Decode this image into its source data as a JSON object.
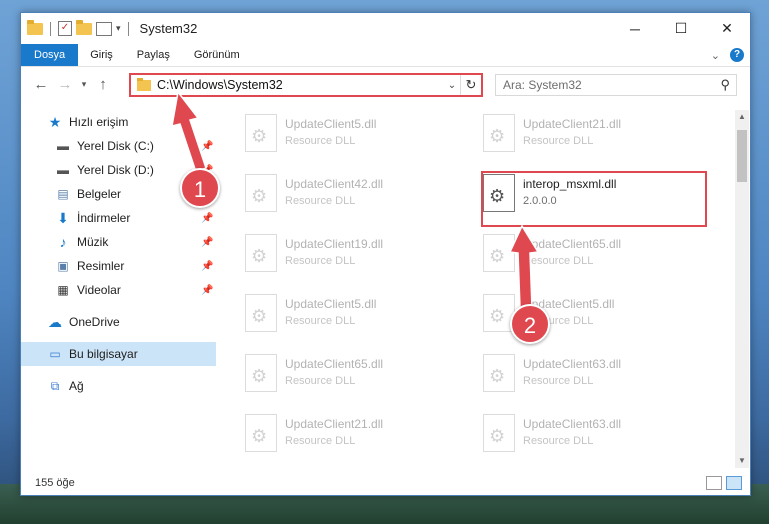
{
  "window": {
    "title": "System32"
  },
  "ribbon": {
    "tabs": [
      "Dosya",
      "Giriş",
      "Paylaş",
      "Görünüm"
    ],
    "help_label": "?"
  },
  "nav": {
    "address": "C:\\Windows\\System32",
    "search_placeholder": "Ara: System32"
  },
  "sidebar": {
    "quick_access": "Hızlı erişim",
    "items": [
      {
        "label": "Yerel Disk (C:)",
        "icon": "drive-icon",
        "pinned": true
      },
      {
        "label": "Yerel Disk (D:)",
        "icon": "drive-icon",
        "pinned": true
      },
      {
        "label": "Belgeler",
        "icon": "documents-icon",
        "pinned": true
      },
      {
        "label": "İndirmeler",
        "icon": "downloads-icon",
        "pinned": true
      },
      {
        "label": "Müzik",
        "icon": "music-icon",
        "pinned": true
      },
      {
        "label": "Resimler",
        "icon": "pictures-icon",
        "pinned": true
      },
      {
        "label": "Videolar",
        "icon": "videos-icon",
        "pinned": true
      }
    ],
    "onedrive": "OneDrive",
    "this_pc": "Bu bilgisayar",
    "network": "Ağ"
  },
  "files": {
    "left": [
      {
        "name": "UpdateClient5.dll",
        "type": "Resource DLL"
      },
      {
        "name": "UpdateClient42.dll",
        "type": "Resource DLL"
      },
      {
        "name": "UpdateClient19.dll",
        "type": "Resource DLL"
      },
      {
        "name": "UpdateClient5.dll",
        "type": "Resource DLL"
      },
      {
        "name": "UpdateClient65.dll",
        "type": "Resource DLL"
      },
      {
        "name": "UpdateClient21.dll",
        "type": "Resource DLL"
      }
    ],
    "right": [
      {
        "name": "UpdateClient21.dll",
        "type": "Resource DLL"
      },
      {
        "name": "interop_msxml.dll",
        "type": "2.0.0.0",
        "highlighted": true
      },
      {
        "name": "UpdateClient65.dll",
        "type": "Resource DLL"
      },
      {
        "name": "UpdateClient5.dll",
        "type": "Resource DLL"
      },
      {
        "name": "UpdateClient63.dll",
        "type": "Resource DLL"
      },
      {
        "name": "UpdateClient63.dll",
        "type": "Resource DLL"
      }
    ]
  },
  "status": {
    "count": "155 öğe"
  },
  "annotations": {
    "step1": "1",
    "step2": "2",
    "color": "#e0484f"
  }
}
